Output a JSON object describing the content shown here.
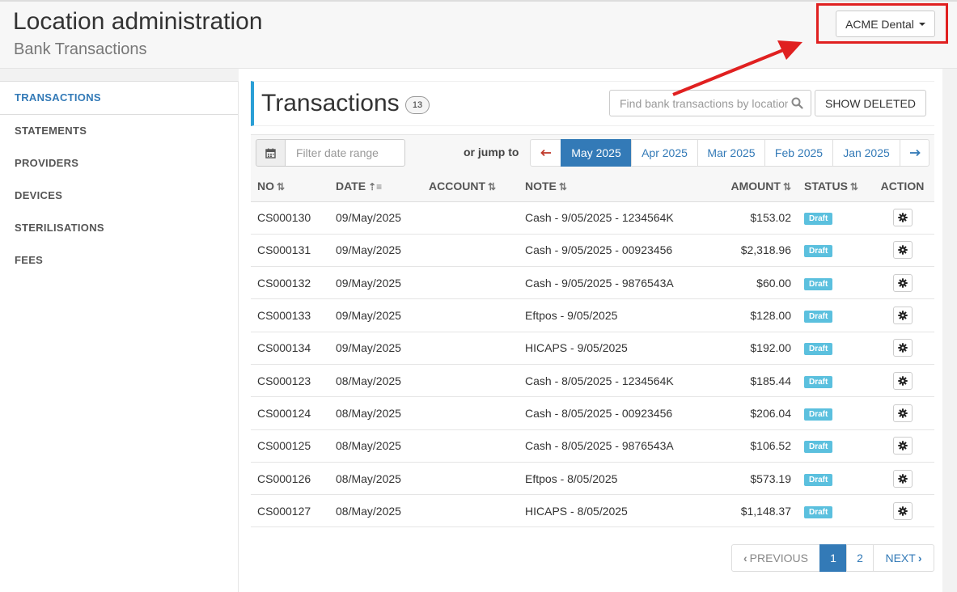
{
  "header": {
    "title": "Location administration",
    "subtitle": "Bank Transactions",
    "location_button": "ACME Dental"
  },
  "sidebar": {
    "items": [
      {
        "label": "TRANSACTIONS",
        "active": true
      },
      {
        "label": "STATEMENTS",
        "active": false
      },
      {
        "label": "PROVIDERS",
        "active": false
      },
      {
        "label": "DEVICES",
        "active": false
      },
      {
        "label": "STERILISATIONS",
        "active": false
      },
      {
        "label": "FEES",
        "active": false
      }
    ]
  },
  "main": {
    "title": "Transactions",
    "count": "13",
    "search_placeholder": "Find bank transactions by location",
    "show_deleted_label": "SHOW DELETED",
    "date_filter_placeholder": "Filter date range",
    "jump_label": "or jump to",
    "months": [
      "May 2025",
      "Apr 2025",
      "Mar 2025",
      "Feb 2025",
      "Jan 2025"
    ],
    "active_month": "May 2025"
  },
  "table": {
    "columns": [
      "NO",
      "DATE",
      "ACCOUNT",
      "NOTE",
      "AMOUNT",
      "STATUS",
      "ACTION"
    ],
    "rows": [
      {
        "no": "CS000130",
        "date": "09/May/2025",
        "account": "",
        "note": "Cash - 9/05/2025 - 1234564K",
        "amount": "$153.02",
        "status": "Draft"
      },
      {
        "no": "CS000131",
        "date": "09/May/2025",
        "account": "",
        "note": "Cash - 9/05/2025 - 00923456",
        "amount": "$2,318.96",
        "status": "Draft"
      },
      {
        "no": "CS000132",
        "date": "09/May/2025",
        "account": "",
        "note": "Cash - 9/05/2025 - 9876543A",
        "amount": "$60.00",
        "status": "Draft"
      },
      {
        "no": "CS000133",
        "date": "09/May/2025",
        "account": "",
        "note": "Eftpos - 9/05/2025",
        "amount": "$128.00",
        "status": "Draft"
      },
      {
        "no": "CS000134",
        "date": "09/May/2025",
        "account": "",
        "note": "HICAPS - 9/05/2025",
        "amount": "$192.00",
        "status": "Draft"
      },
      {
        "no": "CS000123",
        "date": "08/May/2025",
        "account": "",
        "note": "Cash - 8/05/2025 - 1234564K",
        "amount": "$185.44",
        "status": "Draft"
      },
      {
        "no": "CS000124",
        "date": "08/May/2025",
        "account": "",
        "note": "Cash - 8/05/2025 - 00923456",
        "amount": "$206.04",
        "status": "Draft"
      },
      {
        "no": "CS000125",
        "date": "08/May/2025",
        "account": "",
        "note": "Cash - 8/05/2025 - 9876543A",
        "amount": "$106.52",
        "status": "Draft"
      },
      {
        "no": "CS000126",
        "date": "08/May/2025",
        "account": "",
        "note": "Eftpos - 8/05/2025",
        "amount": "$573.19",
        "status": "Draft"
      },
      {
        "no": "CS000127",
        "date": "08/May/2025",
        "account": "",
        "note": "HICAPS - 8/05/2025",
        "amount": "$1,148.37",
        "status": "Draft"
      }
    ]
  },
  "pagination": {
    "previous": "PREVIOUS",
    "pages": [
      "1",
      "2"
    ],
    "active_page": "1",
    "next": "NEXT"
  },
  "colors": {
    "accent": "#337ab7",
    "draft_badge": "#5bc0de",
    "annotation": "#e02020"
  }
}
